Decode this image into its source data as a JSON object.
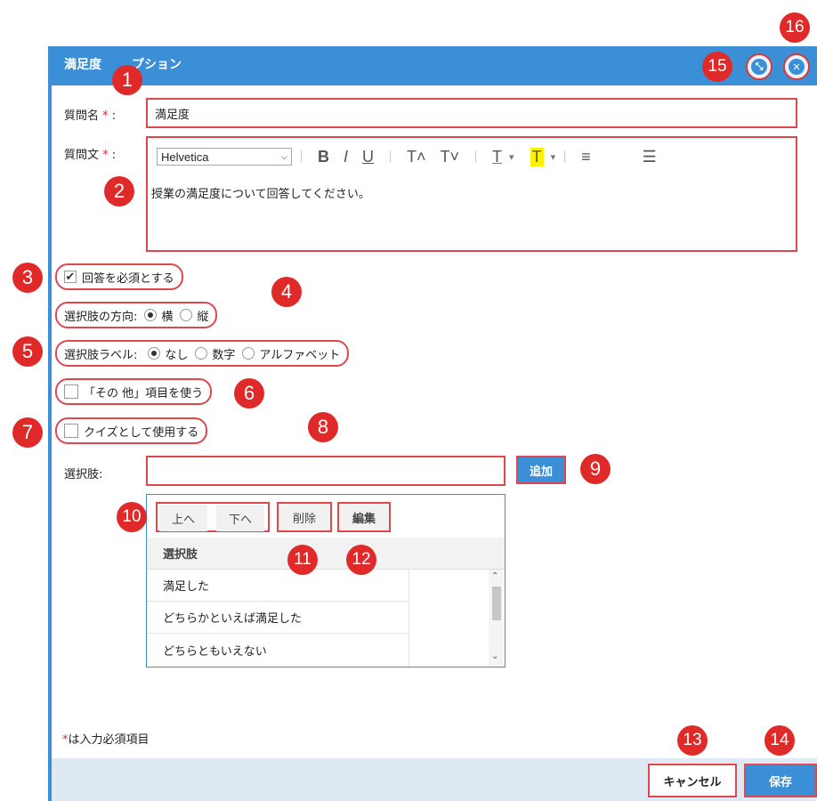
{
  "dialog": {
    "title": "満足度",
    "title_suffix": "プション"
  },
  "question_name": {
    "label": "質問名",
    "required_mark": "*",
    "colon": ":",
    "value": "満足度"
  },
  "question_text": {
    "label": "質問文",
    "required_mark": "*",
    "colon": ":",
    "font": "Helvetica",
    "toolbar": {
      "bold": "B",
      "italic": "I",
      "underline": "U",
      "superscript": "T˄",
      "subscript": "T˅",
      "font_color": "T",
      "highlight": "T",
      "caret": "▾",
      "align": "≡",
      "justify": "☰"
    },
    "body": "授業の満足度について回答してください。"
  },
  "required_checkbox": {
    "label": "回答を必須とする",
    "checked": true
  },
  "direction": {
    "label": "選択肢の方向:",
    "options": [
      "横",
      "縦"
    ],
    "selected": "横"
  },
  "choice_label": {
    "label": "選択肢ラベル:",
    "options": [
      "なし",
      "数字",
      "アルファベット"
    ],
    "selected": "なし"
  },
  "other_item": {
    "label": "「その 他」項目を使う",
    "checked": false
  },
  "quiz": {
    "label": "クイズとして使用する",
    "checked": false
  },
  "choices": {
    "label": "選択肢:",
    "input_value": "",
    "add_button": "追加",
    "toolbar": {
      "up": "上へ",
      "down": "下へ",
      "delete": "削除",
      "edit": "編集"
    },
    "header": "選択肢",
    "items": [
      "満足した",
      "どちらかといえば満足した",
      "どちらともいえない"
    ]
  },
  "footnote": {
    "mark": "*",
    "text": "は入力必須項目"
  },
  "buttons": {
    "cancel": "キャンセル",
    "save": "保存"
  },
  "annotations": [
    "1",
    "2",
    "3",
    "4",
    "5",
    "6",
    "7",
    "8",
    "9",
    "10",
    "11",
    "12",
    "13",
    "14",
    "15",
    "16"
  ],
  "colors": {
    "accent": "#3a8fd6",
    "annotation": "#e02a2a"
  }
}
